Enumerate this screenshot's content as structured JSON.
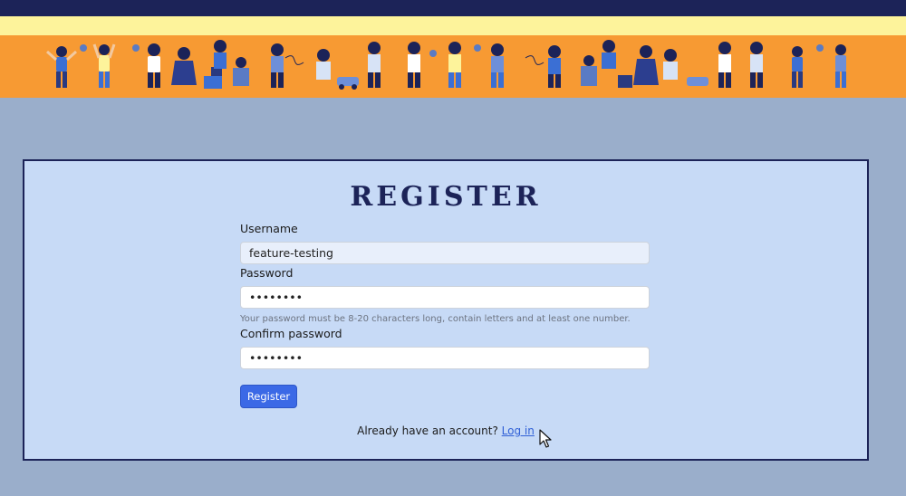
{
  "page": {
    "title": "REGISTER"
  },
  "form": {
    "username_label": "Username",
    "username_value": "feature-testing",
    "password_label": "Password",
    "password_value": "abcdefg1",
    "password_help": "Your password must be 8-20 characters long, contain letters and at least one number.",
    "confirm_label": "Confirm password",
    "confirm_value": "abcdefg1",
    "submit_label": "Register"
  },
  "footer": {
    "prompt": "Already have an account?",
    "login_link": "Log in"
  },
  "colors": {
    "navy": "#1c2358",
    "banner_orange": "#f79a33",
    "pale_yellow": "#fdf39b",
    "background": "#9aaecb",
    "card": "#c7daf6",
    "button_blue": "#3b69e6"
  },
  "icons": [
    "kids-banner-illustration",
    "mouse-pointer-icon"
  ]
}
